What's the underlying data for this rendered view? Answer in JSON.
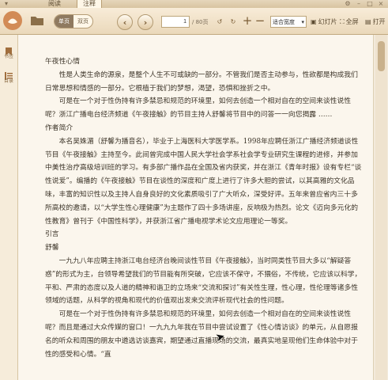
{
  "tabs": [
    "阅读",
    "注释"
  ],
  "toolbar": {
    "view_single": "单页",
    "view_double": "双页",
    "page_current": "1",
    "page_total": "/ 80页",
    "zoom_selected": "适合宽度",
    "slideshow_label": "幻灯片",
    "fullscreen_label": "全屏",
    "book_label": "打开"
  },
  "sidebar": {
    "items": [
      "书签",
      "目录"
    ]
  },
  "content": {
    "paragraphs": [
      "午夜性心情",
      "性是人类生命的源泉，是整个人生不可或缺的一部分。不管我们是否主动参与，性欲都是构成我们日常思想和情感的一部分。它根植于我们的梦想，渴望，恐惧和挫折之中。",
      "可是在一个对于性伪持有许多禁忌和规范的环境里，如何去创造一个相对自在的空间来谈性说性呢？浙江广播电台经济频道《午夜接触》的节目主持人舒馨将节目中的问答一一向您揭露 ……",
      "作者简介",
      "本名吴姝湄（舒馨为播音名），毕业于上海医科大学医学系。1998年应聘任浙江广播经济频道谈性节目《午夜接触》主持至今。此间曾完成中国人民大学社会学系社会学专业研究生课程的进修，并参加中美性治疗高级培训班的学习。有多部广播作品在全国及省内获奖，并在浙江《青年时报》设有专栏“谈性说爱”。编播的《午夜接触》节目在谈性的深度和广度上进行了许多大胆的尝试，以其高雅的文化品味，丰富的知识性以及主持人自身良好的文化素质吸引了广大听众，深受好评。五年来曾应省内三十多所高校的邀请，以“大学生性心理健康”为主题作了四十多场讲座，反响极为热烈。论文《迈向多元化的性教育》曾刊于《中国性科学》，并获浙江省广播电视学术论文应用理论一等奖。",
      "引言",
      "舒馨",
      "一九九八年应聘主持浙江电台经济台晚间谈性节目《午夜接触》，当时同类性节目大多以“解疑答惑”的形式为主，台领导希望我们的节目能有所突破，它应该不保守，不猥俗，不传统，它应该以科学，平和、严肃的态度以及人道的精神和谐卫的立场来“交流和探讨”有关性生理，性心理，性伦理等诸多性领域的话题，从科学的视角和现代的价值观出发来交流评析现代社会的性问题。",
      "可是在一个对于性伪持有许多禁忌和规范的环境里，如何去创造一个相对自在的空间来谈性说性呢？而且是通过大众传媒的窗口！一九九九年我在节目中尝试设置了《性心情访谈》的单元，从自愿报名的听众和周围的朋友中遴选访谈嘉宾，期望通过直播现场的交流，最真实地呈现他们生命体验中对于性的感受和心情。“直"
    ]
  }
}
